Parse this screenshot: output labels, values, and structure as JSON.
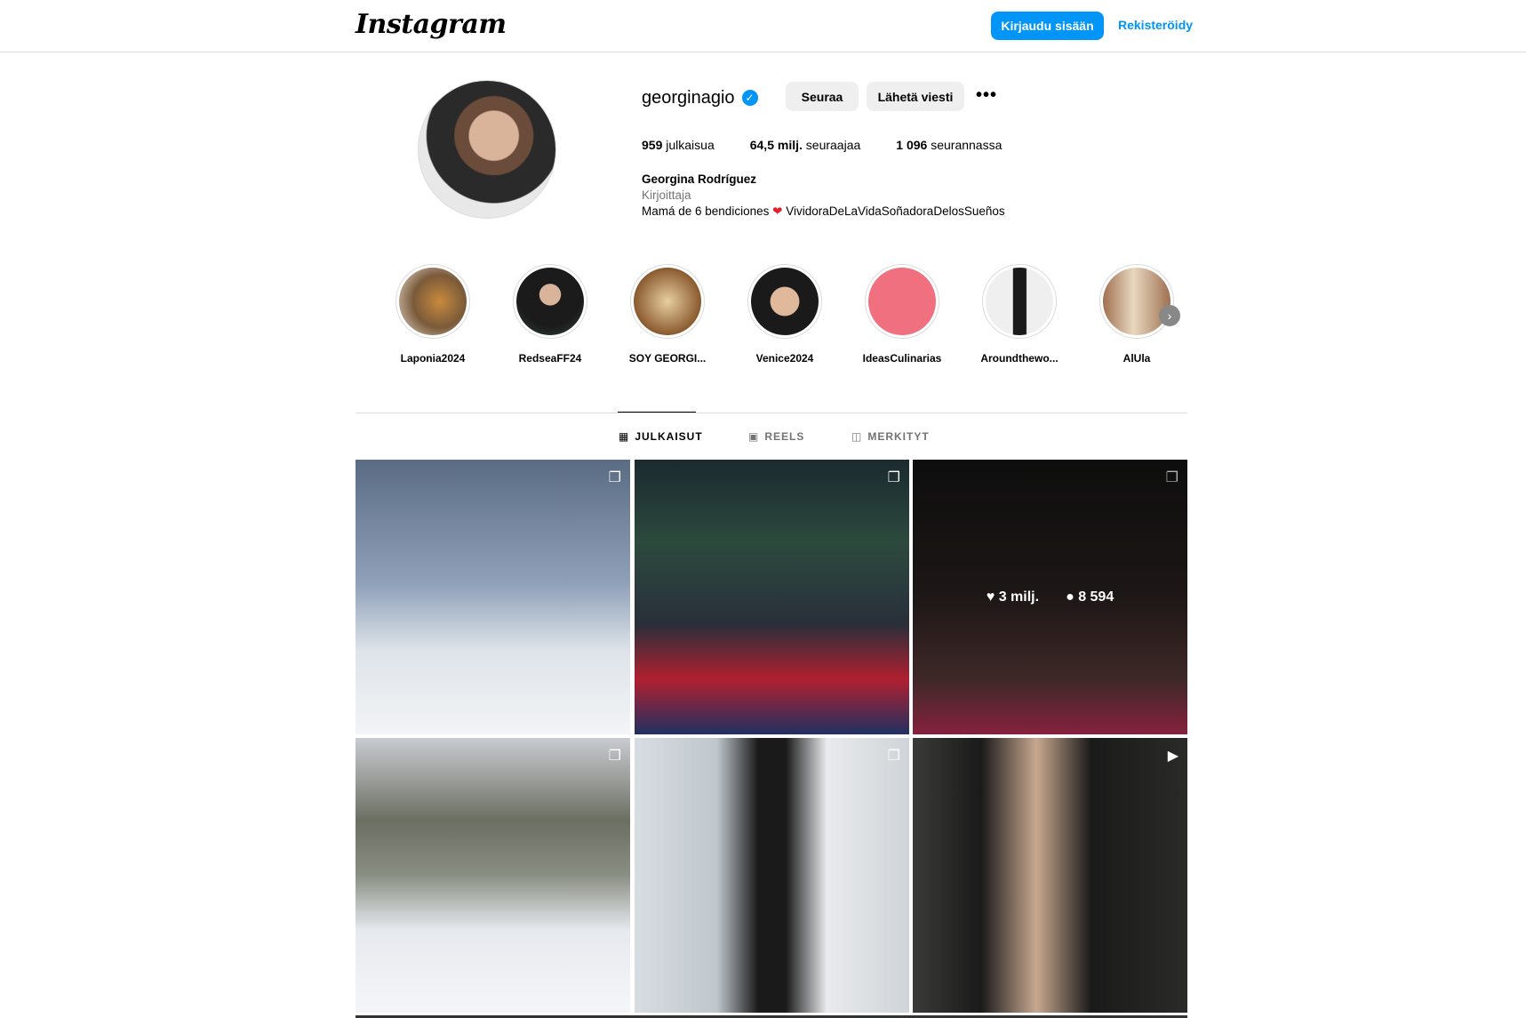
{
  "topbar": {
    "logo": "Instagram",
    "login_label": "Kirjaudu sisään",
    "register_label": "Rekisteröidy"
  },
  "profile": {
    "username": "georginagio",
    "verified": true,
    "follow_label": "Seuraa",
    "message_label": "Lähetä viesti",
    "more_icon": "ellipsis-icon",
    "stats": {
      "posts_value": "959",
      "posts_label": "julkaisua",
      "followers_value": "64,5 milj.",
      "followers_label": "seuraajaa",
      "following_value": "1 096",
      "following_label": "seurannassa"
    },
    "full_name": "Georgina Rodríguez",
    "category": "Kirjoittaja",
    "bio_before": "Mamá de 6 bendiciones",
    "bio_emoji": "❤️",
    "bio_after": "VividoraDeLaVidaSoñadoraDelosSueños"
  },
  "highlights": [
    {
      "label": "Laponia2024"
    },
    {
      "label": "RedseaFF24"
    },
    {
      "label": "SOY GEORGI..."
    },
    {
      "label": "Venice2024"
    },
    {
      "label": "IdeasCulinarias"
    },
    {
      "label": "Aroundthewo..."
    },
    {
      "label": "AlUla"
    }
  ],
  "tabs": [
    {
      "label": "JULKAISUT",
      "icon": "grid-icon",
      "active": true
    },
    {
      "label": "REELS",
      "icon": "reels-icon",
      "active": false
    },
    {
      "label": "MERKITYT",
      "icon": "tagged-icon",
      "active": false
    }
  ],
  "posts": [
    {
      "type_icon": "carousel-icon"
    },
    {
      "type_icon": "carousel-icon"
    },
    {
      "type_icon": "carousel-icon",
      "likes": "3 milj.",
      "comments": "8 594"
    },
    {
      "type_icon": "carousel-icon"
    },
    {
      "type_icon": "carousel-icon"
    },
    {
      "type_icon": "reel-icon"
    }
  ]
}
